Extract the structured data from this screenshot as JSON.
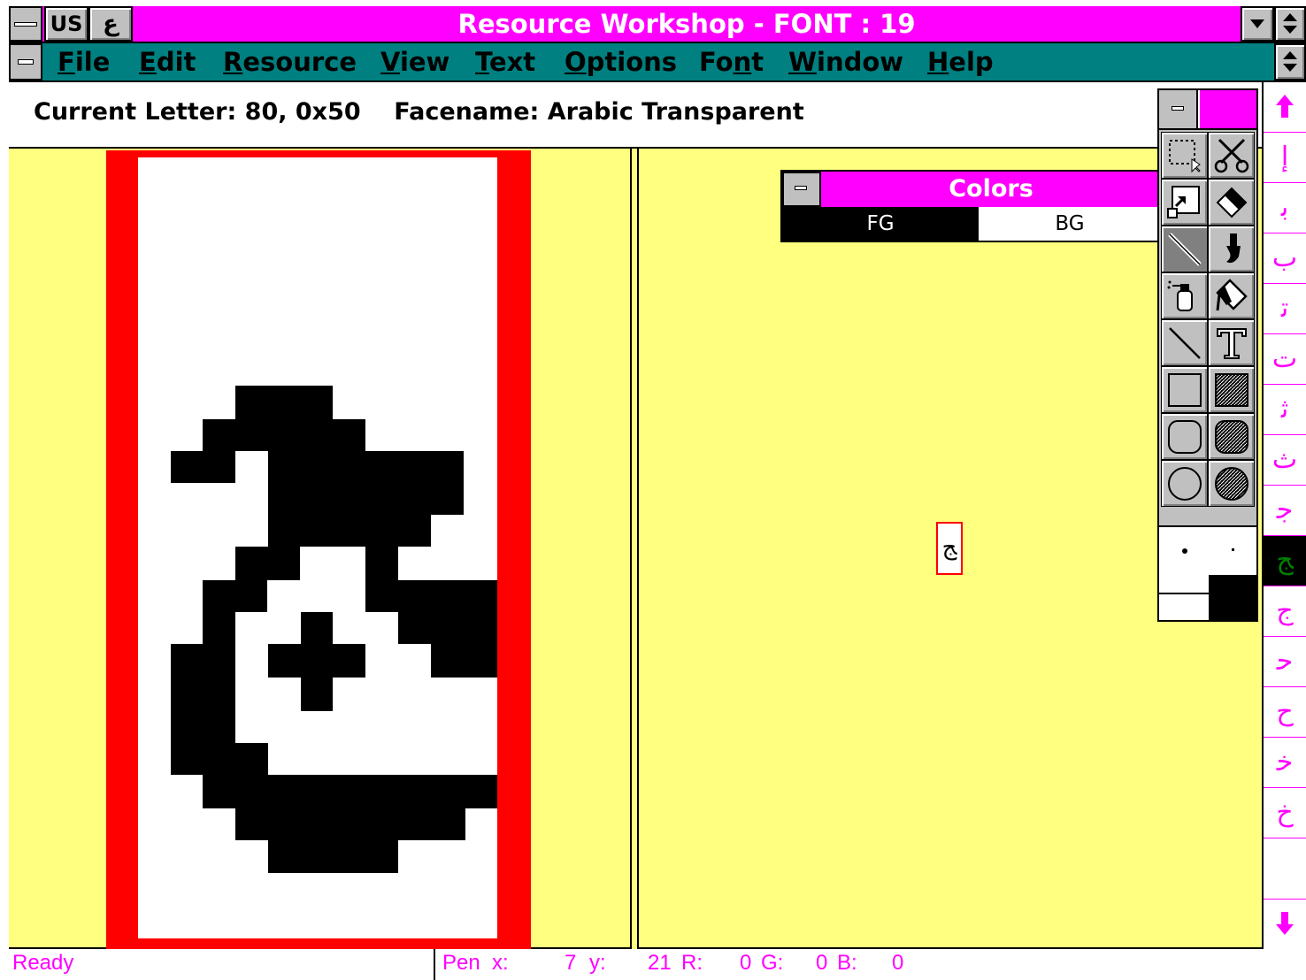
{
  "window": {
    "title": "Resource Workshop - FONT : 19",
    "sys_label_us": "US",
    "sys_label_ar": "ع"
  },
  "menu": {
    "items": [
      {
        "acc": "F",
        "rest": "ile"
      },
      {
        "acc": "E",
        "rest": "dit"
      },
      {
        "acc": "R",
        "rest": "esource"
      },
      {
        "acc": "V",
        "rest": "iew"
      },
      {
        "acc": "T",
        "rest": "ext"
      },
      {
        "acc": "O",
        "rest": "ptions"
      },
      {
        "pre": "Fo",
        "acc": "n",
        "rest": "t"
      },
      {
        "acc": "W",
        "rest": "indow"
      },
      {
        "acc": "H",
        "rest": "elp"
      }
    ]
  },
  "info": {
    "current_letter": "Current Letter: 80, 0x50    Facename: Arabic Transparent"
  },
  "colors_palette": {
    "title": "Colors",
    "fg_label": "FG",
    "bg_label": "BG"
  },
  "toolbox": {
    "tools": [
      "pick-rectangle-icon",
      "scissors-icon",
      "zoom-icon",
      "eraser-icon",
      "pen-icon",
      "paintbrush-icon",
      "airbrush-icon",
      "paint-can-icon",
      "line-icon",
      "text-icon",
      "empty-rectangle-icon",
      "filled-rectangle-icon",
      "empty-rounded-rectangle-icon",
      "filled-rounded-rectangle-icon",
      "empty-ellipse-icon",
      "filled-ellipse-icon"
    ]
  },
  "glyph_strip": {
    "glyphs": [
      "إ",
      "ﺑ",
      "ﺏ",
      "ﺗ",
      "ﺕ",
      "ﺛ",
      "ﺙ",
      "ﺟ",
      "ﺞ",
      "ﺝ",
      "ﺣ",
      "ﺡ",
      "ﺧ",
      "ﺥ"
    ],
    "selected_index": 8
  },
  "status": {
    "ready": "Ready",
    "pen_x_label": "Pen  x:",
    "pen_x": "7",
    "y_label": "y:",
    "y": "21",
    "r_label": "R:",
    "r": "0",
    "g_label": "G:",
    "g": "0",
    "b_label": "B:",
    "b": "0"
  },
  "colors": {
    "title_bar": "#ff00ff",
    "menu_bar": "#008080",
    "work_area": "#ffff80",
    "frame": "#ff0000",
    "status_text": "#ff00ff",
    "selected_glyph": "#008000"
  }
}
